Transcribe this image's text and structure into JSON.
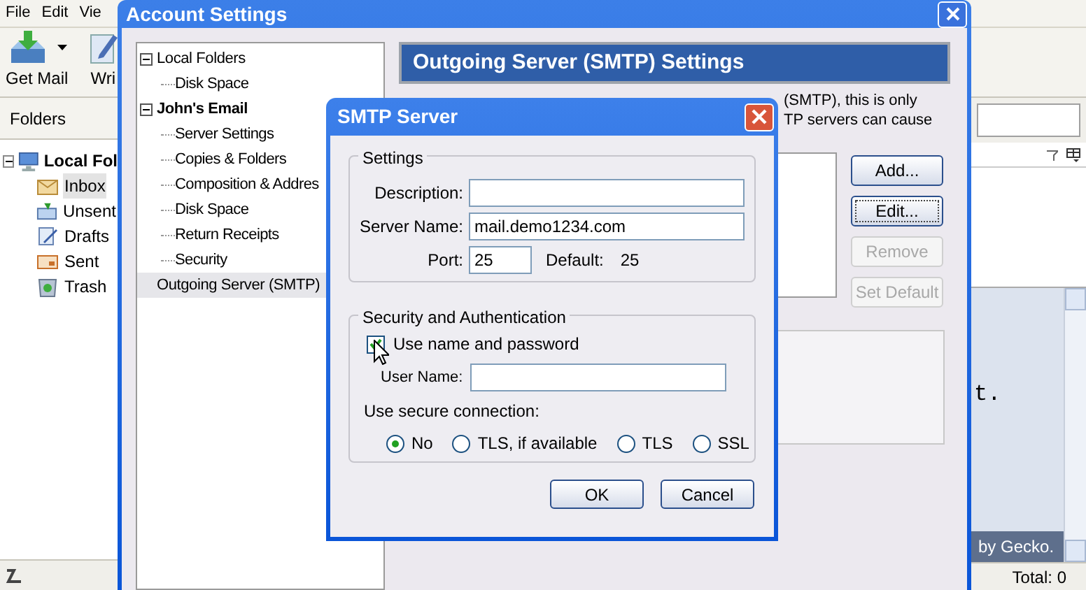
{
  "main_window": {
    "menu": [
      "File",
      "Edit",
      "Vie"
    ],
    "toolbar": [
      {
        "label": "Get Mail",
        "kind": "getmail"
      },
      {
        "label": "Wri",
        "kind": "write"
      }
    ],
    "folders_header": "Folders",
    "folders": [
      {
        "label": "Local Fol",
        "expanded": true,
        "selected": false,
        "children": [
          {
            "label": "Inbox",
            "kind": "inbox",
            "selected": true
          },
          {
            "label": "Unsent",
            "kind": "unsent",
            "selected": false
          },
          {
            "label": "Drafts",
            "kind": "drafts",
            "selected": false
          },
          {
            "label": "Sent",
            "kind": "sent",
            "selected": false
          },
          {
            "label": "Trash",
            "kind": "trash",
            "selected": false
          }
        ]
      }
    ],
    "preview_texts": [
      "t.",
      "by Gecko."
    ],
    "status": "Total: 0"
  },
  "account_settings": {
    "title": "Account Settings",
    "tree": [
      {
        "label": "Local Folders",
        "bold": false,
        "expanded": true,
        "selected": false,
        "children": [
          {
            "label": "Disk Space",
            "selected": false
          }
        ]
      },
      {
        "label": "John's Email",
        "bold": true,
        "expanded": true,
        "selected": false,
        "children": [
          {
            "label": "Server Settings",
            "selected": false
          },
          {
            "label": "Copies & Folders",
            "selected": false
          },
          {
            "label": "Composition & Addres",
            "selected": false
          },
          {
            "label": "Disk Space",
            "selected": false
          },
          {
            "label": "Return Receipts",
            "selected": false
          },
          {
            "label": "Security",
            "selected": false
          }
        ]
      },
      {
        "label": "Outgoing Server (SMTP)",
        "bold": false,
        "selected": true
      }
    ],
    "heading": "Outgoing Server (SMTP) Settings",
    "description": [
      "(SMTP), this is only",
      "TP servers can cause"
    ],
    "buttons": [
      {
        "label": "Add...",
        "disabled": false,
        "focused": false
      },
      {
        "label": "Edit...",
        "disabled": false,
        "focused": true
      },
      {
        "label": "Remove",
        "disabled": true,
        "focused": false
      },
      {
        "label": "Set Default",
        "disabled": true,
        "focused": false
      }
    ]
  },
  "smtp_dialog": {
    "title": "SMTP Server",
    "settings_group": "Settings",
    "description": {
      "label": "Description:"
    },
    "server_name": {
      "label": "Server Name:",
      "value": "mail.demo1234.com"
    },
    "port": {
      "label": "Port:",
      "value": "25",
      "default_label": "Default:",
      "default_value": "25"
    },
    "security_group": "Security and Authentication",
    "use_name_password": {
      "label": "Use name and password",
      "checked": true
    },
    "user_name": {
      "label": "User Name:"
    },
    "secure_connection_label": "Use secure connection:",
    "secure_options": [
      {
        "label": "No",
        "selected": true
      },
      {
        "label": "TLS, if available",
        "selected": false
      },
      {
        "label": "TLS",
        "selected": false
      },
      {
        "label": "SSL",
        "selected": false
      }
    ],
    "buttons": [
      "OK",
      "Cancel"
    ]
  }
}
